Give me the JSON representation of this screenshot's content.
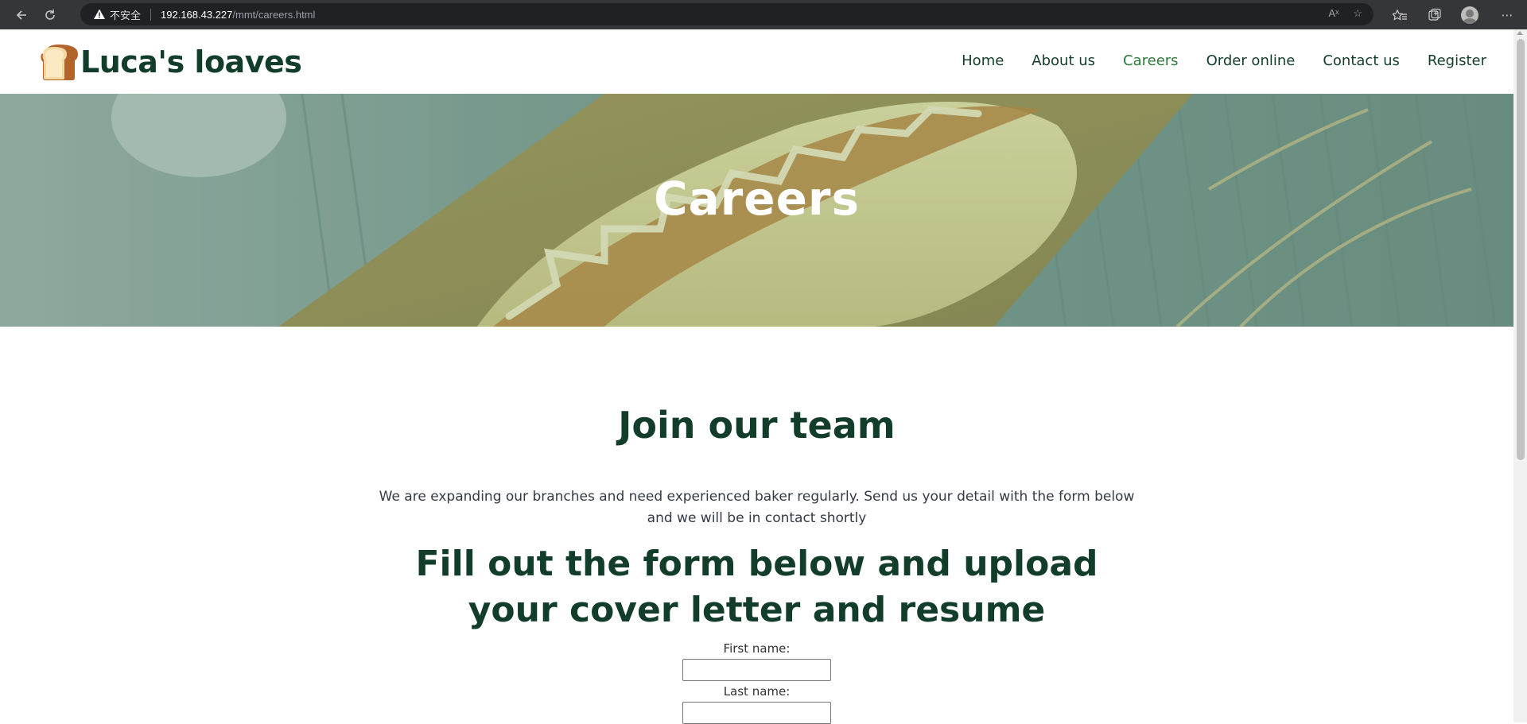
{
  "browser": {
    "insecure_label": "不安全",
    "url_host": "192.168.43.227",
    "url_path": "/mmt/careers.html",
    "read_aloud_label": "Aˣ"
  },
  "site": {
    "brand": "Luca's loaves",
    "nav": [
      {
        "label": "Home"
      },
      {
        "label": "About us"
      },
      {
        "label": "Careers",
        "active": true
      },
      {
        "label": "Order online"
      },
      {
        "label": "Contact us"
      },
      {
        "label": "Register"
      }
    ]
  },
  "hero": {
    "title": "Careers"
  },
  "main": {
    "heading": "Join our team",
    "intro": "We are expanding our branches and need experienced baker regularly. Send us your detail with the form below and we will be in contact shortly",
    "form_heading": "Fill out the form below and upload your cover letter and resume",
    "form": {
      "first_name_label": "First name:",
      "first_name_value": "",
      "last_name_label": "Last name:",
      "last_name_value": ""
    }
  },
  "colors": {
    "brand_dark": "#123d2a",
    "nav_active": "#2b7a3b",
    "hero_overlay": "#7f9f90"
  }
}
